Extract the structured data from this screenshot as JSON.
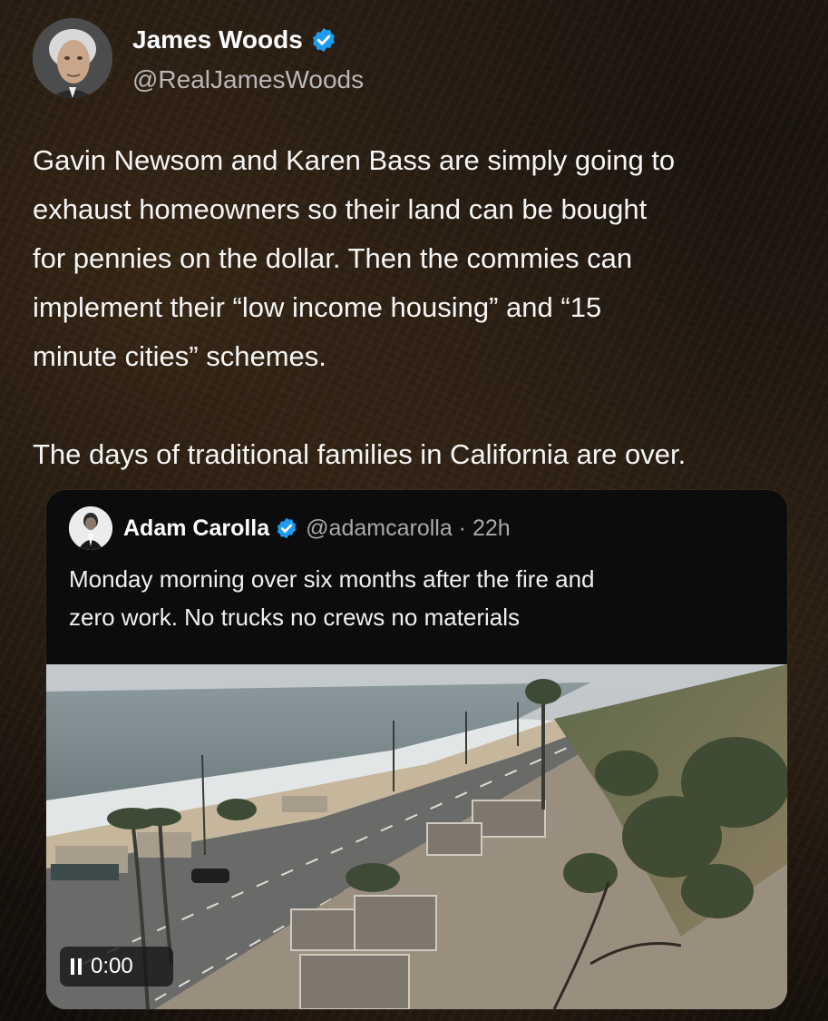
{
  "author": {
    "name": "James Woods",
    "handle": "@RealJamesWoods",
    "verified_icon": "verified-badge-icon",
    "verified_color": "#1d9bf0"
  },
  "tweet": {
    "paragraph1_lines": [
      "Gavin Newsom and Karen Bass are simply going to",
      "exhaust homeowners so their land can be bought",
      "for pennies on the dollar. Then the commies can",
      "implement their “low income housing” and “15",
      "minute cities” schemes."
    ],
    "paragraph2": "The days of traditional families in California are over."
  },
  "quoted": {
    "name": "Adam Carolla",
    "handle_time": "@adamcarolla · 22h",
    "text_lines": [
      "Monday morning over six months after the fire and",
      "zero work. No trucks no crews no materials"
    ],
    "video": {
      "time": "0:00",
      "control_icon": "pause-icon"
    }
  }
}
